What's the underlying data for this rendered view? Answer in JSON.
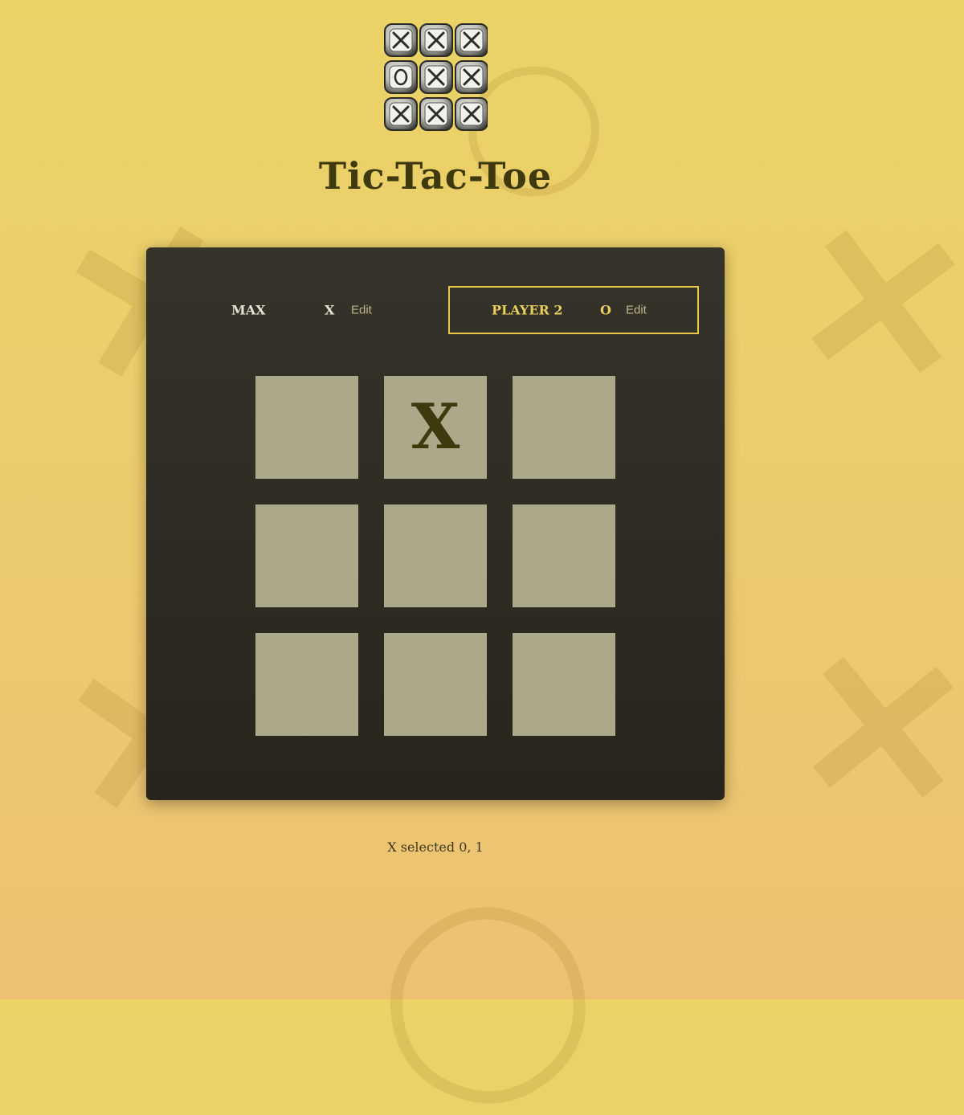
{
  "header": {
    "title": "Tic-Tac-Toe",
    "logo_icon": "tic-tac-toe-logo-icon",
    "logo_cells": [
      "X",
      "X",
      "X",
      "O",
      "X",
      "X",
      "X",
      "X",
      "X"
    ]
  },
  "players": [
    {
      "name": "Max",
      "symbol": "X",
      "edit_label": "Edit",
      "active": false
    },
    {
      "name": "Player 2",
      "symbol": "O",
      "edit_label": "Edit",
      "active": true
    }
  ],
  "board": [
    [
      "",
      "X",
      ""
    ],
    [
      "",
      "",
      ""
    ],
    [
      "",
      "",
      ""
    ]
  ],
  "log": {
    "entries": [
      "X selected 0, 1"
    ]
  },
  "colors": {
    "background": "#ebd366",
    "panel": "#302d24",
    "cell": "#aca98b",
    "mark": "#3e3a0e",
    "active_border": "#e9c54a"
  }
}
